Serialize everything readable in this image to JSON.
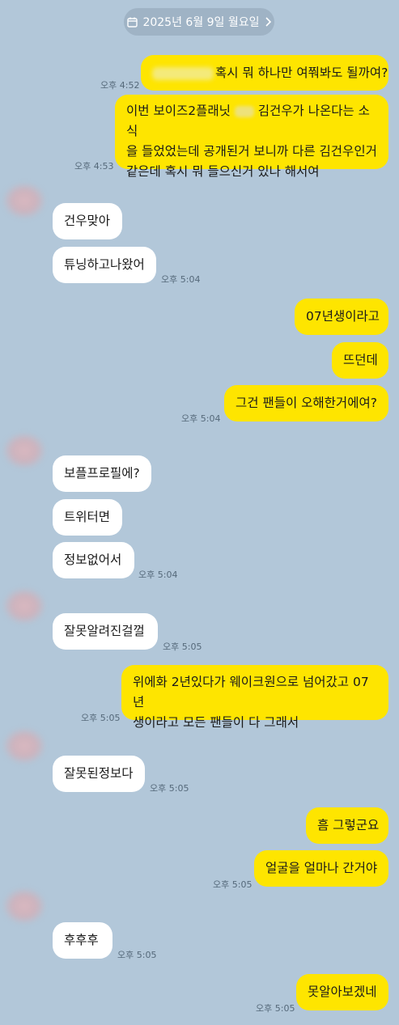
{
  "date_divider": "2025년 6월 9일 월요일",
  "messages": [
    {
      "text": "혹시 뭐 하나만 여쭤봐도 될까여?",
      "time": "오후 4:52"
    },
    {
      "line1_a": "이번 보이즈2플래닛",
      "line1_b": "김건우가 나온다는 소식",
      "line2": "을 들었었는데 공개된거 보니까 다른 김건우인거",
      "line3": "같은데 혹시 뭐 들으신거 있나 해서여",
      "time": "오후 4:53"
    },
    {
      "text": "건우맞아"
    },
    {
      "text": "튜닝하고나왔어",
      "time": "오후 5:04"
    },
    {
      "text": "07년생이라고"
    },
    {
      "text": "뜨던데"
    },
    {
      "text": "그건 팬들이 오해한거에여?",
      "time": "오후 5:04"
    },
    {
      "text": "보플프로필에?"
    },
    {
      "text": "트위터면"
    },
    {
      "text": "정보없어서",
      "time": "오후 5:04"
    },
    {
      "text": "잘못알려진걸껄",
      "time": "오후 5:05"
    },
    {
      "line1": "위에화 2년있다가 웨이크원으로 넘어갔고 07년",
      "line2": "생이라고 모든 팬들이 다 그래서",
      "time": "오후 5:05"
    },
    {
      "text": "잘못된정보다",
      "time": "오후 5:05"
    },
    {
      "text": "흠 그렇군요"
    },
    {
      "text": "얼굴을 얼마나 간거야",
      "time": "오후 5:05"
    },
    {
      "text": "후후후",
      "time": "오후 5:05"
    },
    {
      "text": "못알아보겠네",
      "time": "오후 5:05"
    }
  ]
}
